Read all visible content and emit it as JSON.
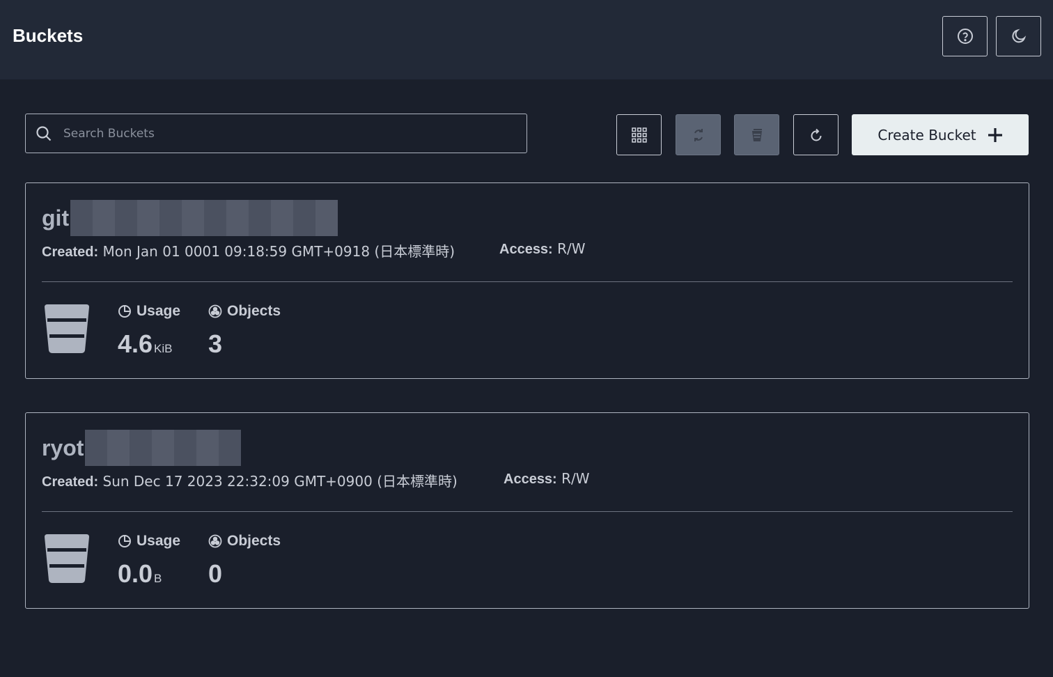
{
  "header": {
    "title": "Buckets",
    "help_icon": "question-circle-icon",
    "theme_icon": "moon-icon"
  },
  "toolbar": {
    "search_placeholder": "Search Buckets",
    "search_icon": "search-icon",
    "buttons": [
      "grid-icon",
      "replication-icon",
      "lifecycle-icon",
      "refresh-icon"
    ],
    "create_label": "Create Bucket",
    "create_icon": "plus-icon"
  },
  "labels": {
    "created": "Created:",
    "access": "Access:",
    "usage": "Usage",
    "objects": "Objects"
  },
  "buckets": [
    {
      "name": "git",
      "created": "Mon Jan 01 0001 09:18:59 GMT+0918 (日本標準時)",
      "access": "R/W",
      "usage_value": "4.6",
      "usage_unit": "KiB",
      "objects": "3"
    },
    {
      "name": "ryot",
      "created": "Sun Dec 17 2023 22:32:09 GMT+0900 (日本標準時)",
      "access": "R/W",
      "usage_value": "0.0",
      "usage_unit": "B",
      "objects": "0"
    }
  ],
  "colors": {
    "background": "#1a1f2b",
    "header": "#222937",
    "create_button": "#e8eef0"
  }
}
